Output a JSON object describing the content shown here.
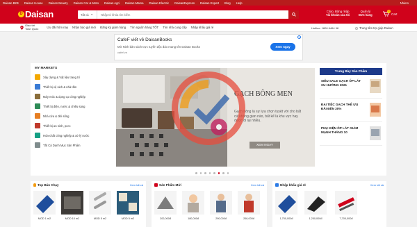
{
  "topnav": {
    "items": [
      "Daisan B2B",
      "Daisan House",
      "Daisan Beauty",
      "Daisan Car & Moto",
      "Daisan Agri",
      "Daisan Mama",
      "Daisan Electric",
      "DaisanExpress",
      "Daisan Export",
      "Blog",
      "Help"
    ],
    "user": "Nhiem"
  },
  "header": {
    "logo": "Daisan",
    "search_cat": "Tất cả",
    "search_placeholder": "Nhập từ khóa tìm kiếm",
    "link1_a": "Chào, Đăng nhập",
    "link1_b": "Tài khoản của tôi",
    "link2_a": "Quản lý",
    "link2_b": "Đơn hàng",
    "cart_label": "Cart",
    "cart_count": "0"
  },
  "subbar": {
    "loc_a": "Giao tới",
    "loc_b": "Toàn Quốc",
    "nav": [
      "Ưu đãi hôm nay",
      "Nhận báo giá mới",
      "Đăng ký giảm hàng",
      "Tìm nguồn hàng TỐT",
      "Tìm nhà cung cấp",
      "Nhập khẩu giá rẻ"
    ],
    "hotline": "Hotline: 1800 6464 98",
    "support": "Trung tâm trợ giúp Daisan"
  },
  "ad": {
    "title": "CafeF viết về DaisanBooks",
    "text": "Mở Ninh bàn sách trực tuyến độc đáo mang tên Daisan Books",
    "url": "cafef.vn",
    "button": "Xem ngay",
    "info": "i"
  },
  "markets": {
    "title": "MY MARKETS",
    "items": [
      "Xây dựng & Vật liệu trang trí",
      "Thiết bị vệ sinh & nhà tắm",
      "Máy móc & dụng cụ công nghiệp",
      "Thiết bị điện, nước & chiếu sáng",
      "Nhà cửa & đời sống",
      "Thiết bị an ninh, pccc",
      "Hóa-chất công nghiệp & xử lý nước",
      "Tất Cả Danh Mục Sản Phẩm"
    ],
    "colors": [
      "#f4a900",
      "#3a7bd5",
      "#8a6d3b",
      "#2e8b57",
      "#e67e22",
      "#c0392b",
      "#16a085",
      "#7f8c8d"
    ]
  },
  "slider": {
    "title": "GẠCH BÔNG MEN",
    "text": "Gạch bông là sự lựa chọn tuyệt vời cho bất cứ không gian nào, bất kể là khu vực hay được đi lại nhiều.",
    "button": "XEM NGAY",
    "dots": 8,
    "active_dot": 5
  },
  "trend": {
    "title": "Trưng Bày Sản Phẩm",
    "items": [
      "SIÊU SALE GẠCH ỐP LÁT XU HƯỚNG 2021",
      "ĐẠI TIỆC GẠCH THẺ ƯU ĐÃI ĐẾN 30%",
      "PHỤ KIỆN ỐP LÁT GIẢM MẠNH THÁNG 10"
    ]
  },
  "sections": [
    {
      "title": "Top Bán Chạy",
      "link": "Xem tất cả",
      "products": [
        {
          "label": "MOD 1 m2"
        },
        {
          "label": "MOD 10 m2"
        },
        {
          "label": "MOD 5 m2"
        },
        {
          "label": "MOD 5 m2"
        }
      ]
    },
    {
      "title": "Sản Phẩm Mới",
      "link": "Xem tất cả",
      "products": [
        {
          "label": "200,000đ"
        },
        {
          "label": "180,000đ"
        },
        {
          "label": "290,000đ"
        },
        {
          "label": "260,000đ"
        }
      ]
    },
    {
      "title": "Nhập khẩu giá rẻ",
      "link": "Xem tất cả",
      "products": [
        {
          "label": "1,750,000đ"
        },
        {
          "label": "1,250,000đ"
        },
        {
          "label": "7,700,000đ"
        }
      ]
    }
  ]
}
